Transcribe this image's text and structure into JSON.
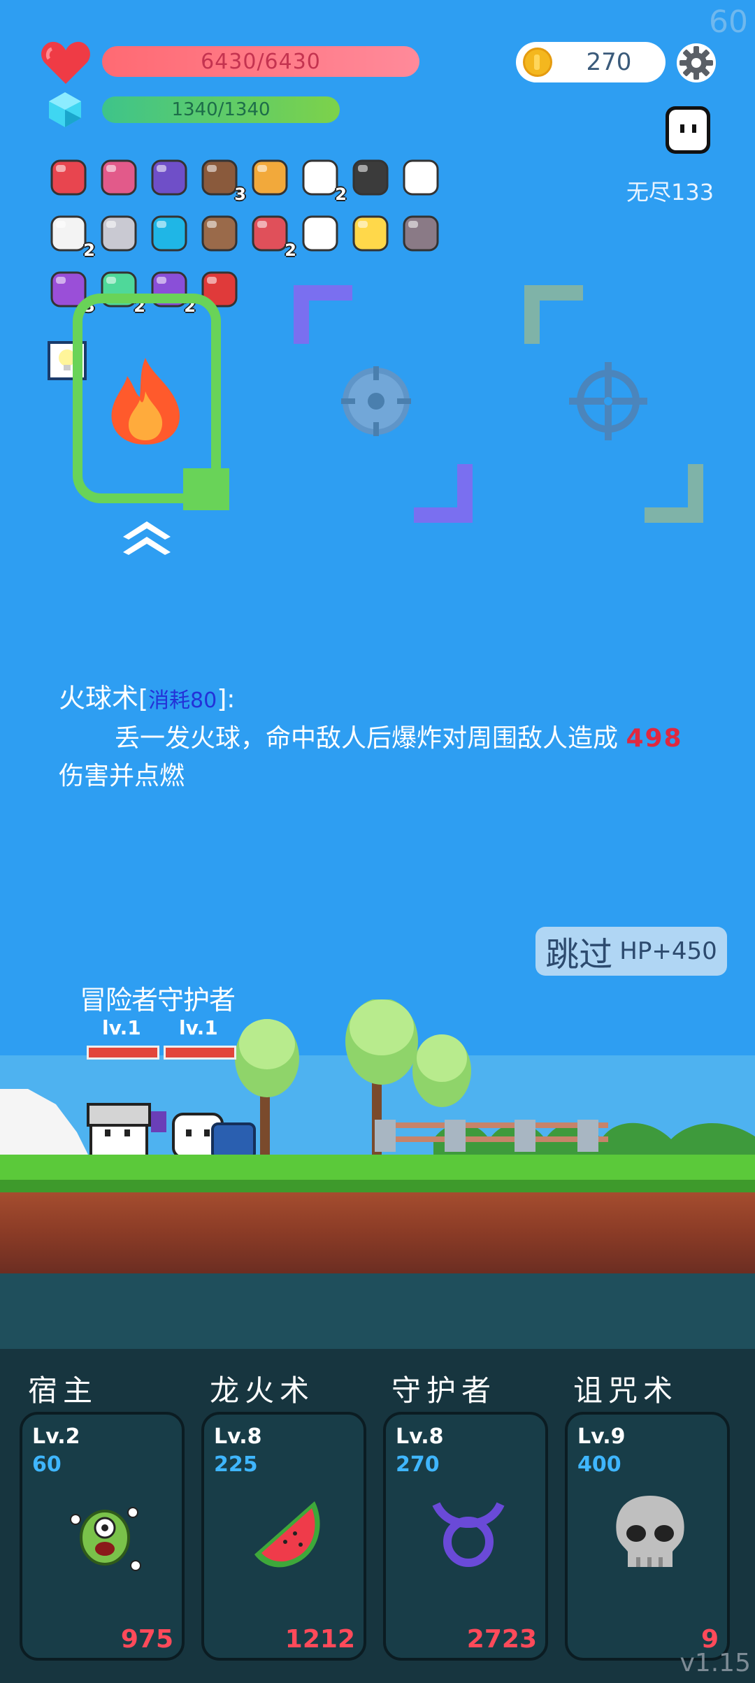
{
  "fps": "60",
  "version": "v1.15",
  "status": {
    "hp_text": "6430/6430",
    "mp_text": "1340/1340",
    "coins": "270",
    "mode": "无尽133",
    "hp_color": "#ff6a73",
    "mp_color": "#3ec48a"
  },
  "inventory": [
    {
      "icon": "watermelon-icon",
      "count": ""
    },
    {
      "icon": "jam-jar-icon",
      "count": ""
    },
    {
      "icon": "wizard-hat-icon",
      "count": ""
    },
    {
      "icon": "coconut-icon",
      "count": "3"
    },
    {
      "icon": "book-icon",
      "count": ""
    },
    {
      "icon": "envelope-icon",
      "count": "2"
    },
    {
      "icon": "cauldron-icon",
      "count": ""
    },
    {
      "icon": "glove-icon",
      "count": ""
    },
    {
      "icon": "lightbulb-icon",
      "count": "2"
    },
    {
      "icon": "unicorn-icon",
      "count": ""
    },
    {
      "icon": "blue-gem-icon",
      "count": ""
    },
    {
      "icon": "wooden-shield-icon",
      "count": ""
    },
    {
      "icon": "red-shield-icon",
      "count": "2"
    },
    {
      "icon": "ghost-icon",
      "count": ""
    },
    {
      "icon": "magic-wand-icon",
      "count": ""
    },
    {
      "icon": "tombstone-icon",
      "count": ""
    },
    {
      "icon": "crystal-ball-icon",
      "count": "3"
    },
    {
      "icon": "green-spirit-icon",
      "count": "2"
    },
    {
      "icon": "purple-chest-icon",
      "count": "2"
    },
    {
      "icon": "hearts-icon",
      "count": ""
    }
  ],
  "skill": {
    "name": "火球术",
    "cost_open": "[",
    "cost_label": "消耗80",
    "cost_close": "]:",
    "desc_before": "丢一发火球，命中敌人后爆炸对周围敌人造成 ",
    "damage": "498",
    "desc_after": "伤害并点燃"
  },
  "skip": {
    "label": "跳过",
    "bonus": "HP+450"
  },
  "party": {
    "names": "冒险者守护者",
    "lv1": "lv.1",
    "lv2": "lv.1"
  },
  "cards": [
    {
      "title": "宿主",
      "level": "Lv.2",
      "cost": "60",
      "power": "975",
      "icon": "eyeball-monster-icon"
    },
    {
      "title": "龙火术",
      "level": "Lv.8",
      "cost": "225",
      "power": "1212",
      "icon": "watermelon-icon"
    },
    {
      "title": "守护者",
      "level": "Lv.8",
      "cost": "270",
      "power": "2723",
      "icon": "taurus-icon"
    },
    {
      "title": "诅咒术",
      "level": "Lv.9",
      "cost": "400",
      "power": "9",
      "icon": "skull-icon"
    }
  ]
}
